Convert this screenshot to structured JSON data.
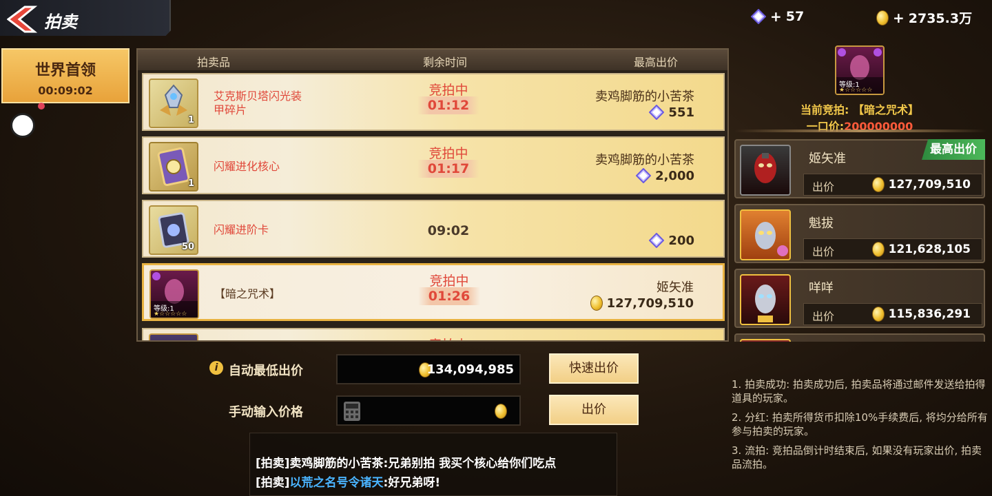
{
  "header": {
    "title": "拍卖"
  },
  "currencies": [
    {
      "icon": "crystal-icon",
      "plus": "+",
      "value": "57"
    },
    {
      "icon": "gold-coin-icon",
      "plus": "+",
      "value": "2735.3万"
    }
  ],
  "left_tab": {
    "title": "世界首领",
    "timer": "00:09:02"
  },
  "table": {
    "headers": [
      "拍卖品",
      "剩余时间",
      "最高出价"
    ],
    "rows": [
      {
        "name": "艾克斯贝塔闪光装甲碎片",
        "count": "1",
        "status": "竞拍中",
        "timer": "01:12",
        "bidder": "卖鸡脚筋的小苦茶",
        "currency": "crystal-icon",
        "price": "551"
      },
      {
        "name": "闪耀进化核心",
        "count": "1",
        "status": "竞拍中",
        "timer": "01:17",
        "bidder": "卖鸡脚筋的小苦茶",
        "currency": "crystal-icon",
        "price": "2,000"
      },
      {
        "name": "闪耀进阶卡",
        "count": "50",
        "status": "",
        "timer": "09:02",
        "bidder": "",
        "currency": "crystal-icon",
        "price": "200"
      },
      {
        "name": "【暗之咒术】",
        "count": "",
        "level": "等级:1",
        "status": "竞拍中",
        "timer": "01:26",
        "bidder": "姬矢准",
        "currency": "gold-coin-icon",
        "price": "127,709,510"
      },
      {
        "name": "",
        "count": "",
        "status": "竞拍中",
        "timer": "",
        "bidder": "",
        "currency": "",
        "price": ""
      }
    ]
  },
  "controls": {
    "auto_label": "自动最低出价",
    "auto_value": "134,094,985",
    "quick_bid": "快速出价",
    "manual_label": "手动输入价格",
    "bid": "出价"
  },
  "chat": {
    "line1": "[拍卖]卖鸡脚筋的小苦茶:兄弟别拍 我买个核心给你们吃点",
    "line2_prefix": "[拍卖]",
    "line2_link": "以荒之名号令诸天",
    "line2_suffix": ":好兄弟呀!"
  },
  "right": {
    "item_level": "等级:1",
    "current_label": "当前竞拍:",
    "current_item": "【暗之咒术】",
    "buyout_label": "一口价:",
    "buyout_value": "200000000",
    "top_badge": "最高出价",
    "bid_label": "出价",
    "bids": [
      {
        "name": "姬矢准",
        "amount": "127,709,510"
      },
      {
        "name": "魁拔",
        "amount": "121,628,105"
      },
      {
        "name": "咩咩",
        "amount": "115,836,291"
      }
    ]
  },
  "rules": [
    "1. 拍卖成功: 拍卖成功后, 拍卖品将通过邮件发送给拍得道具的玩家。",
    "2. 分红: 拍卖所得货币扣除10%手续费后, 将均分给所有参与拍卖的玩家。",
    "3. 流拍: 竞拍品倒计时结束后, 如果没有玩家出价, 拍卖品流拍。"
  ],
  "colors": {
    "accent_gold": "#f2c84a",
    "status_red": "#e0483a",
    "link_blue": "#4ab4ff",
    "badge_green": "#4cb85a"
  }
}
